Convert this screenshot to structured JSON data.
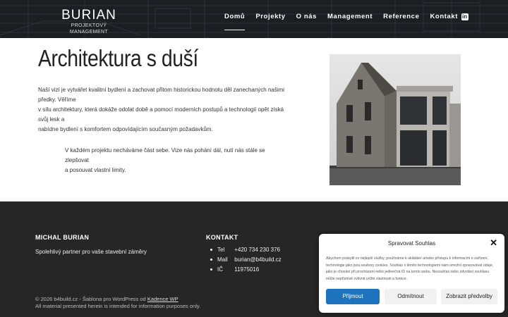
{
  "header": {
    "logo_name": "BURIAN",
    "logo_sub": "PROJEKTOVÝ MANAGEMENT",
    "nav": [
      "Domů",
      "Projekty",
      "O nás",
      "Management",
      "Reference",
      "Kontakt"
    ],
    "active_nav": "Domů",
    "social_icon": "linkedin-icon"
  },
  "main": {
    "title": "Architektura s duší",
    "intro_lines": [
      "Naší vizí je vytvářet kvalitní bydlení a zachovat přitom historickou hodnotu děl zanechaných našimi předky. Věříme",
      "v sílu architektury, která dokáže odolat době a pomocí moderních postupů a technologií opět získá svůj lesk a",
      "nabídne bydlení s komfortem odpovídajícím současným požadavkům."
    ],
    "quote_lines": [
      "V každém projektu necháváme část sebe. Vize nás pohání dál, nutí nás stále se zlepšovat",
      "a posouvat vlastní limity."
    ]
  },
  "footer": {
    "company_heading": "MICHAL BURIAN",
    "tagline": "Spolehlivý partner pro vaše stavební záměry",
    "contact_heading": "KONTAKT",
    "contacts": [
      {
        "label": "Tel",
        "value": "+420 734 230 376"
      },
      {
        "label": "Mail",
        "value": "burian@b4build.cz"
      },
      {
        "label": "IČ",
        "value": "11975016"
      }
    ],
    "copyright_prefix": "© 2026 b4build.cz - Šablona pro WordPress od",
    "copyright_link": "Kadence WP",
    "disclaimer": "All material presented herein is intended for information purposes only."
  },
  "consent": {
    "title": "Spravovat Souhlas",
    "text_lines": [
      "Abychom poskytli co nejlepší služby, používáme k ukládání a/nebo přístupu k informacím o zařízení,",
      "technologie jako jsou soubory cookies. Souhlas s těmito technologiemi nám umožní zpracovávat údaje,",
      "jako je chování při procházení nebo jedinečná ID na tomto webu. Nesouhlas nebo odvolání souhlasu",
      "může nepříznivě ovlivnit určité vlastnosti a funkce."
    ],
    "accept": "Přijmout",
    "deny": "Odmítnout",
    "prefs": "Zobrazit předvolby"
  },
  "colors": {
    "header_bg": "#1a1f24",
    "footer_bg": "#262626",
    "accent": "#1e73be"
  }
}
